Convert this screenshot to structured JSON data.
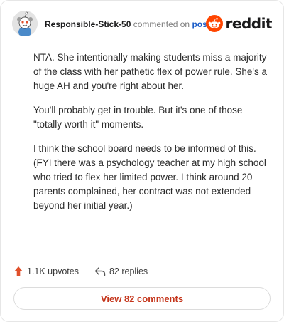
{
  "header": {
    "username": "Responsible-Stick-50",
    "commented_on": "commented on",
    "post_link": "post",
    "brand": "reddit"
  },
  "comment": {
    "paragraphs": [
      "NTA. She intentionally making students miss a majority of the class with her pathetic flex of power rule. She's a huge AH and you're right about her.",
      "You'll probably get in trouble. But it's one of those \"totally worth it\" moments.",
      "I think the school board needs to be informed of this. (FYI there was a psychology teacher at my high school who tried to flex her limited power. I think around 20 parents complained, her contract was not extended beyond her initial year.)"
    ]
  },
  "actions": {
    "upvotes": "1.1K upvotes",
    "replies": "82 replies"
  },
  "footer": {
    "view_comments": "View 82 comments"
  },
  "icons": {
    "upvote": "upvote-arrow-icon",
    "reply": "reply-arrow-icon",
    "avatar": "snoo-avatar",
    "logo": "reddit-snoo-logo"
  },
  "colors": {
    "upvote": "#e0502b",
    "link": "#1a5cc8",
    "button_text": "#c4341a",
    "brand": "#ff4500"
  }
}
